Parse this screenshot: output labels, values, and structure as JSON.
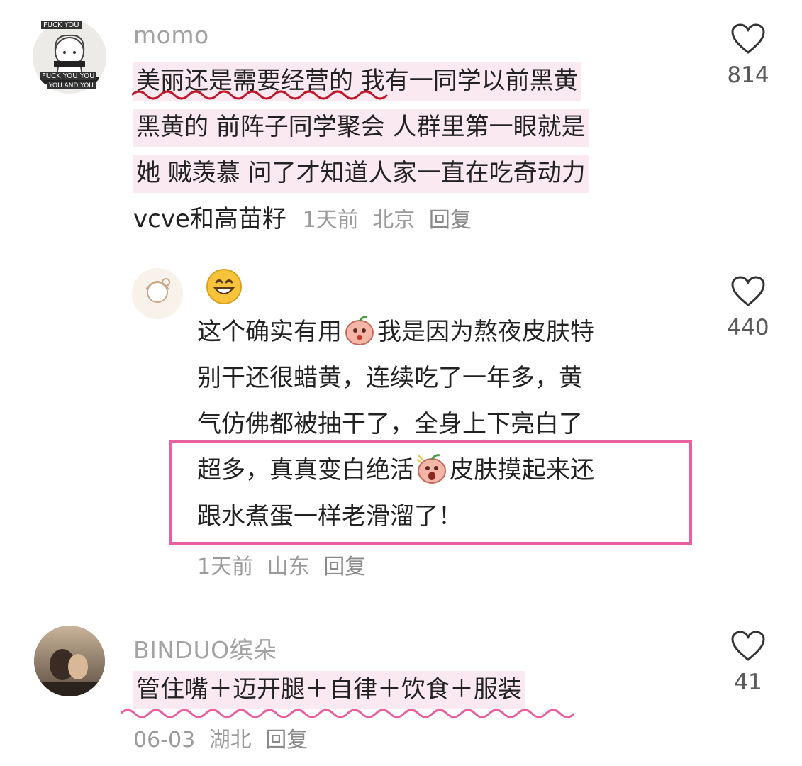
{
  "comments": [
    {
      "username": "momo",
      "lines": [
        "美丽还是需要经营的 我有一同学以前黑黄",
        "黑黄的 前阵子同学聚会 人群里第一眼就是",
        "她 贼羡慕 问了才知道人家一直在吃奇动力",
        "vcve和高苗籽"
      ],
      "meta": {
        "time": "1天前",
        "location": "北京",
        "reply": "回复"
      },
      "likes": "814",
      "avatar_text": [
        "FUCK YOU",
        "FUCK YOU YOU",
        "YOU AND YOU"
      ]
    },
    {
      "username_emoji": "grinning-face-emoji",
      "lines_parts": [
        [
          "这个确实有用",
          "我是因为熬夜皮肤特"
        ],
        [
          "别干还很蜡黄，连续吃了一年多，黄"
        ],
        [
          "气仿佛都被抽干了，全身上下亮白了"
        ],
        [
          "超多，真真变白绝活",
          "皮肤摸起来还"
        ],
        [
          "跟水煮蛋一样老滑溜了！"
        ]
      ],
      "meta": {
        "time": "1天前",
        "location": "山东",
        "reply": "回复"
      },
      "likes": "440"
    },
    {
      "username": "BINDUO缤朵",
      "lines": [
        "管住嘴＋迈开腿＋自律＋饮食＋服装"
      ],
      "meta": {
        "time": "06-03",
        "location": "湖北",
        "reply": "回复"
      },
      "likes": "41"
    }
  ],
  "colors": {
    "highlight": "#fbe9f1",
    "pink_border": "#e8609f",
    "wavy_red": "#c0182a",
    "wavy_pink": "#e8609f"
  }
}
